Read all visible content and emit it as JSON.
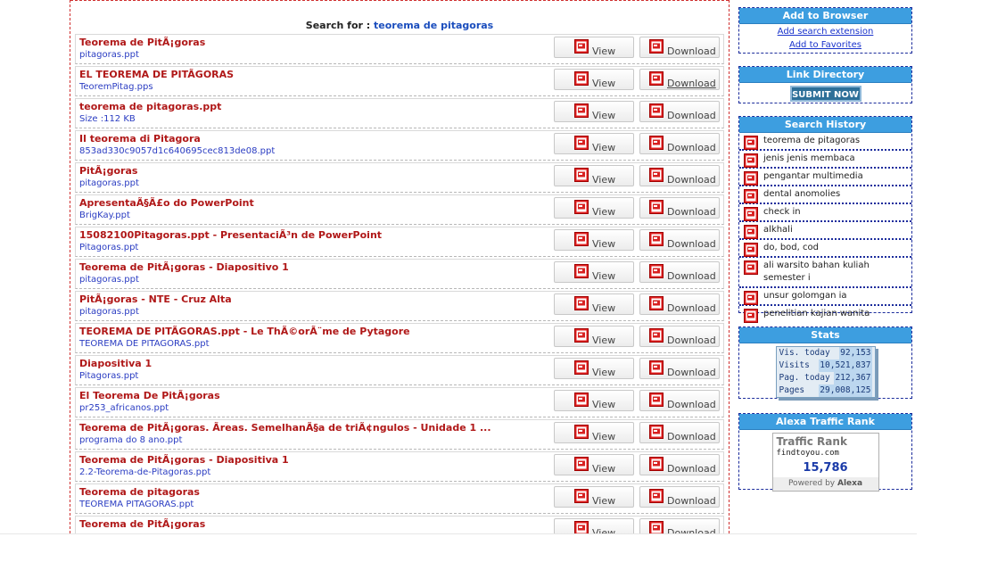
{
  "search": {
    "label": "Search for :",
    "term": "teorema de pitagoras"
  },
  "buttons": {
    "view": "View",
    "download": "Download"
  },
  "results": [
    {
      "title": "Teorema de PitÃ¡goras",
      "sub": "pitagoras.ppt"
    },
    {
      "title": "EL TEOREMA DE PITÃGORAS",
      "sub": "TeoremPitag.pps"
    },
    {
      "title": "teorema de pitagoras.ppt",
      "sub": "Size :112 KB"
    },
    {
      "title": "Il teorema di Pitagora",
      "sub": "853ad330c9057d1c640695cec813de08.ppt"
    },
    {
      "title": "PitÃ¡goras",
      "sub": "pitagoras.ppt"
    },
    {
      "title": "ApresentaÃ§Ã£o do PowerPoint",
      "sub": "BrigKay.ppt"
    },
    {
      "title": "15082100Pitagoras.ppt - PresentaciÃ³n de PowerPoint",
      "sub": "Pitagoras.ppt"
    },
    {
      "title": "Teorema de PitÃ¡goras - Diapositivo 1",
      "sub": "pitagoras.ppt"
    },
    {
      "title": "PitÃ¡goras - NTE - Cruz Alta",
      "sub": "pitagoras.ppt"
    },
    {
      "title": "TEOREMA DE PITÃGORAS.ppt - Le ThÃ©orÃ¨me de Pytagore",
      "sub": "TEOREMA DE PITÃGORAS.ppt"
    },
    {
      "title": "Diapositiva 1",
      "sub": "Pitagoras.ppt"
    },
    {
      "title": "El Teorema De PitÃ¡goras",
      "sub": "pr253_africanos.ppt"
    },
    {
      "title": "Teorema de PitÃ¡goras. Ãreas. SemelhanÃ§a de triÃ¢ngulos - Unidade 1 ...",
      "sub": "programa do 8 ano.ppt"
    },
    {
      "title": "Teorema de PitÃ¡goras - Diapositiva 1",
      "sub": "2.2-Teorema-de-Pitagoras.ppt"
    },
    {
      "title": "Teorema de pitagoras",
      "sub": "TEOREMA PITAGORAS.ppt"
    },
    {
      "title": "Teorema de PitÃ¡goras",
      "sub": ""
    }
  ],
  "sidebar": {
    "browser": {
      "title": "Add to Browser",
      "link1": "Add search extension",
      "link2": "Add to Favorites"
    },
    "directory": {
      "title": "Link Directory",
      "button": "SUBMIT NOW"
    },
    "history": {
      "title": "Search History",
      "items": [
        "teorema de pitagoras",
        "jenis jenis membaca",
        "pengantar multimedia",
        "dental anomolies",
        "check in",
        "alkhali",
        "do, bod, cod",
        "ali warsito bahan kuliah semester i",
        "unsur golomgan ia",
        "penelitian kajian wanita"
      ]
    },
    "stats": {
      "title": "Stats",
      "lines": [
        {
          "label": "Vis. today",
          "value": "92,153"
        },
        {
          "label": "Visits",
          "value": "10,521,837"
        },
        {
          "label": "Pag. today",
          "value": "212,367"
        },
        {
          "label": "Pages",
          "value": "29,008,125"
        }
      ]
    },
    "alexa": {
      "title": "Alexa Traffic Rank",
      "label": "Traffic Rank",
      "domain": "findtoyou.com",
      "rank": "15,786",
      "powered": "Powered by",
      "brand": "Alexa"
    }
  },
  "colors": {
    "accent": "#3d9ee0",
    "title_red": "#b01818",
    "link_blue": "#2a3cc2",
    "border_red": "#d03030"
  }
}
